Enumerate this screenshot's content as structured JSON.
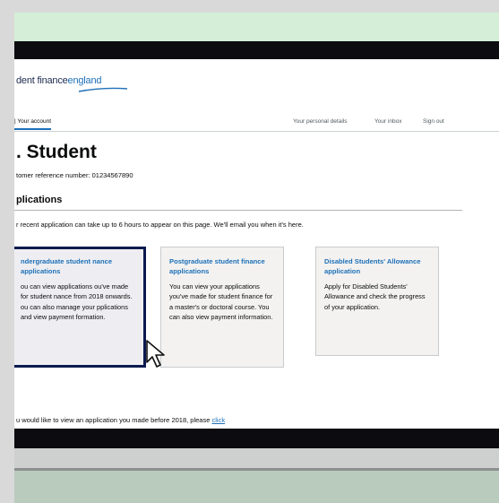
{
  "logo": {
    "part1": "dent finance",
    "part2": "england"
  },
  "nav": {
    "account": "| Your account",
    "personal_details": "Your personal details",
    "inbox": "Your inbox",
    "sign_out": "Sign out"
  },
  "page": {
    "title": ". Student",
    "customer_ref": "tomer reference number: 01234567890",
    "applications_heading": "plications",
    "notice": "r recent application can take up to 6 hours to appear on this page. We'll email you when it's here."
  },
  "cards": [
    {
      "title": "ndergraduate student nance applications",
      "body": "ou can view applications ou've made for student nance from 2018 onwards. ou can also manage your pplications and view payment formation."
    },
    {
      "title": "Postgraduate student finance applications",
      "body": "You can view your applications you've made for student finance for a master's or doctoral course. You can also view payment information."
    },
    {
      "title": "Disabled Students' Allowance application",
      "body": "Apply for Disabled Students' Allowance and check the progress of your application."
    }
  ],
  "before2018": {
    "text": "u would like to view an application you made before 2018, please ",
    "link": "click"
  },
  "colors": {
    "link_blue": "#1d70b8",
    "focus_border": "#0b1a4e",
    "text": "#0b0c0c"
  },
  "icons": {
    "cursor": "mouse-pointer-icon"
  }
}
